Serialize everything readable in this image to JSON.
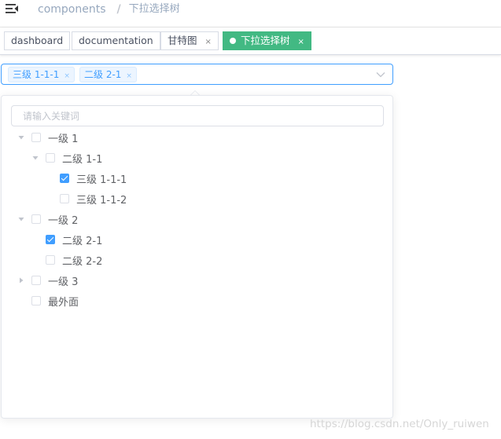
{
  "navbar": {
    "breadcrumb": [
      {
        "label": "components"
      },
      {
        "label": "下拉选择树"
      }
    ],
    "separator": "/"
  },
  "tags": [
    {
      "label": "dashboard",
      "active": false
    },
    {
      "label": "documentation",
      "active": false
    },
    {
      "label": "甘特图",
      "active": false,
      "close": "×"
    },
    {
      "label": "下拉选择树",
      "active": true,
      "close": "×"
    }
  ],
  "select": {
    "selected_chips": [
      {
        "label": "三级 1-1-1",
        "close": "×"
      },
      {
        "label": "二级 2-1",
        "close": "×"
      }
    ]
  },
  "dropdown": {
    "filter_placeholder": "请输入关键词",
    "tree": [
      {
        "label": "一级 1",
        "level": 0,
        "expand": "expanded",
        "checked": false
      },
      {
        "label": "二级 1-1",
        "level": 1,
        "expand": "expanded",
        "checked": false
      },
      {
        "label": "三级 1-1-1",
        "level": 2,
        "expand": "none",
        "checked": true
      },
      {
        "label": "三级 1-1-2",
        "level": 2,
        "expand": "none",
        "checked": false
      },
      {
        "label": "一级 2",
        "level": 0,
        "expand": "expanded",
        "checked": false
      },
      {
        "label": "二级 2-1",
        "level": 1,
        "expand": "none",
        "checked": true
      },
      {
        "label": "二级 2-2",
        "level": 1,
        "expand": "none",
        "checked": false
      },
      {
        "label": "一级 3",
        "level": 0,
        "expand": "collapsed",
        "checked": false
      },
      {
        "label": "最外面",
        "level": 0,
        "expand": "none",
        "checked": false
      }
    ]
  },
  "watermark": "https://blog.csdn.net/Only_ruiwen",
  "colors": {
    "primary": "#409eff",
    "active_tag": "#42b983",
    "text": "#606266"
  }
}
